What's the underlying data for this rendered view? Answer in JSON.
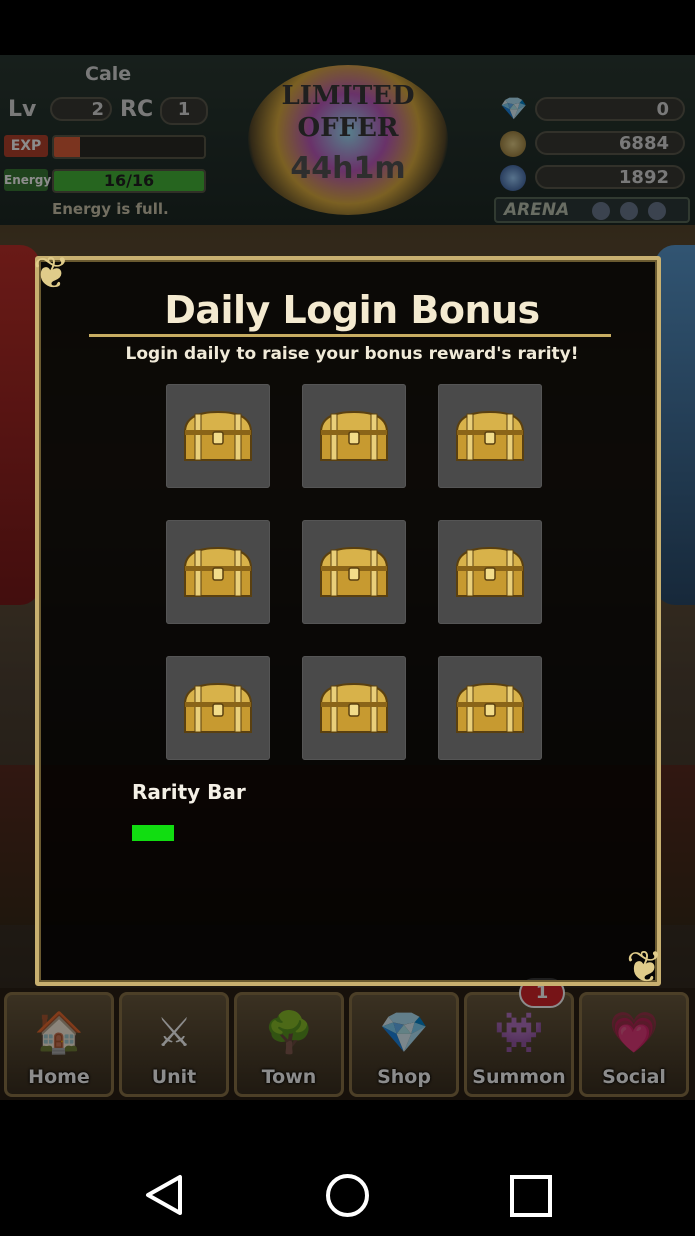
{
  "status_bar": {},
  "header": {
    "player_name": "Cale",
    "level_label": "Lv",
    "level_value": "2",
    "rc_label": "RC",
    "rc_value": "1",
    "exp_label": "EXP",
    "exp_progress": 0.17,
    "energy_label": "Energy",
    "energy_value": "16/16",
    "energy_progress": 1.0,
    "energy_status": "Energy is full.",
    "limited_offer_line1": "LIMITED",
    "limited_offer_line2": "OFFER",
    "limited_offer_timer": "44h1m",
    "gems": "0",
    "zel": "6884",
    "karma": "1892",
    "arena_label": "ARENA"
  },
  "dialog": {
    "title": "Daily Login Bonus",
    "subtitle": "Login daily to raise your bonus reward's rarity!",
    "chests": [
      {
        "icon": "treasure-chest-icon"
      },
      {
        "icon": "treasure-chest-icon"
      },
      {
        "icon": "treasure-chest-icon"
      },
      {
        "icon": "treasure-chest-icon"
      },
      {
        "icon": "treasure-chest-icon"
      },
      {
        "icon": "treasure-chest-icon"
      },
      {
        "icon": "treasure-chest-icon"
      },
      {
        "icon": "treasure-chest-icon"
      },
      {
        "icon": "treasure-chest-icon"
      }
    ],
    "rarity_label": "Rarity Bar",
    "rarity_color": "#11dd11"
  },
  "bottom_nav": {
    "home": "Home",
    "unit": "Unit",
    "town": "Town",
    "shop": "Shop",
    "summon": "Summon",
    "summon_badge": "1",
    "social": "Social"
  },
  "colors": {
    "dialog_border": "#c8b070",
    "title_rule": "#c8ad62",
    "exp_fill": "#e0603a",
    "energy_fill": "#45b83a"
  },
  "system_nav": {
    "back": "back-icon",
    "home": "home-circle-icon",
    "recents": "recents-square-icon"
  }
}
